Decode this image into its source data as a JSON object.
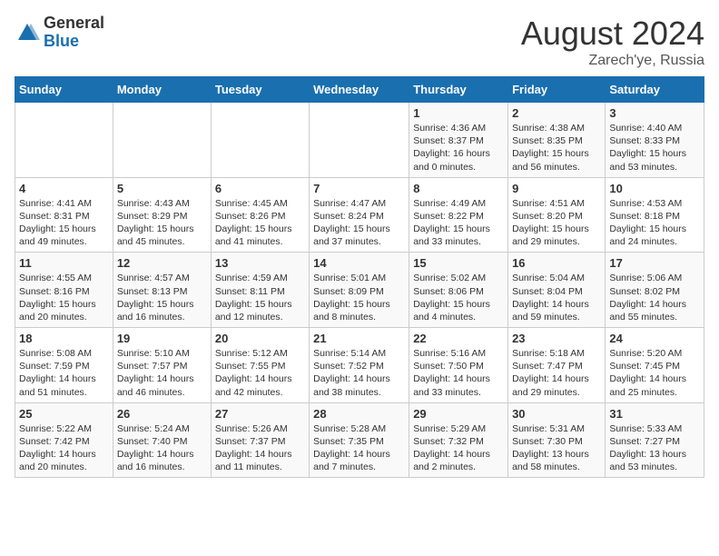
{
  "header": {
    "logo_general": "General",
    "logo_blue": "Blue",
    "month_year": "August 2024",
    "location": "Zarech'ye, Russia"
  },
  "days_of_week": [
    "Sunday",
    "Monday",
    "Tuesday",
    "Wednesday",
    "Thursday",
    "Friday",
    "Saturday"
  ],
  "weeks": [
    [
      {
        "num": "",
        "detail": ""
      },
      {
        "num": "",
        "detail": ""
      },
      {
        "num": "",
        "detail": ""
      },
      {
        "num": "",
        "detail": ""
      },
      {
        "num": "1",
        "detail": "Sunrise: 4:36 AM\nSunset: 8:37 PM\nDaylight: 16 hours\nand 0 minutes."
      },
      {
        "num": "2",
        "detail": "Sunrise: 4:38 AM\nSunset: 8:35 PM\nDaylight: 15 hours\nand 56 minutes."
      },
      {
        "num": "3",
        "detail": "Sunrise: 4:40 AM\nSunset: 8:33 PM\nDaylight: 15 hours\nand 53 minutes."
      }
    ],
    [
      {
        "num": "4",
        "detail": "Sunrise: 4:41 AM\nSunset: 8:31 PM\nDaylight: 15 hours\nand 49 minutes."
      },
      {
        "num": "5",
        "detail": "Sunrise: 4:43 AM\nSunset: 8:29 PM\nDaylight: 15 hours\nand 45 minutes."
      },
      {
        "num": "6",
        "detail": "Sunrise: 4:45 AM\nSunset: 8:26 PM\nDaylight: 15 hours\nand 41 minutes."
      },
      {
        "num": "7",
        "detail": "Sunrise: 4:47 AM\nSunset: 8:24 PM\nDaylight: 15 hours\nand 37 minutes."
      },
      {
        "num": "8",
        "detail": "Sunrise: 4:49 AM\nSunset: 8:22 PM\nDaylight: 15 hours\nand 33 minutes."
      },
      {
        "num": "9",
        "detail": "Sunrise: 4:51 AM\nSunset: 8:20 PM\nDaylight: 15 hours\nand 29 minutes."
      },
      {
        "num": "10",
        "detail": "Sunrise: 4:53 AM\nSunset: 8:18 PM\nDaylight: 15 hours\nand 24 minutes."
      }
    ],
    [
      {
        "num": "11",
        "detail": "Sunrise: 4:55 AM\nSunset: 8:16 PM\nDaylight: 15 hours\nand 20 minutes."
      },
      {
        "num": "12",
        "detail": "Sunrise: 4:57 AM\nSunset: 8:13 PM\nDaylight: 15 hours\nand 16 minutes."
      },
      {
        "num": "13",
        "detail": "Sunrise: 4:59 AM\nSunset: 8:11 PM\nDaylight: 15 hours\nand 12 minutes."
      },
      {
        "num": "14",
        "detail": "Sunrise: 5:01 AM\nSunset: 8:09 PM\nDaylight: 15 hours\nand 8 minutes."
      },
      {
        "num": "15",
        "detail": "Sunrise: 5:02 AM\nSunset: 8:06 PM\nDaylight: 15 hours\nand 4 minutes."
      },
      {
        "num": "16",
        "detail": "Sunrise: 5:04 AM\nSunset: 8:04 PM\nDaylight: 14 hours\nand 59 minutes."
      },
      {
        "num": "17",
        "detail": "Sunrise: 5:06 AM\nSunset: 8:02 PM\nDaylight: 14 hours\nand 55 minutes."
      }
    ],
    [
      {
        "num": "18",
        "detail": "Sunrise: 5:08 AM\nSunset: 7:59 PM\nDaylight: 14 hours\nand 51 minutes."
      },
      {
        "num": "19",
        "detail": "Sunrise: 5:10 AM\nSunset: 7:57 PM\nDaylight: 14 hours\nand 46 minutes."
      },
      {
        "num": "20",
        "detail": "Sunrise: 5:12 AM\nSunset: 7:55 PM\nDaylight: 14 hours\nand 42 minutes."
      },
      {
        "num": "21",
        "detail": "Sunrise: 5:14 AM\nSunset: 7:52 PM\nDaylight: 14 hours\nand 38 minutes."
      },
      {
        "num": "22",
        "detail": "Sunrise: 5:16 AM\nSunset: 7:50 PM\nDaylight: 14 hours\nand 33 minutes."
      },
      {
        "num": "23",
        "detail": "Sunrise: 5:18 AM\nSunset: 7:47 PM\nDaylight: 14 hours\nand 29 minutes."
      },
      {
        "num": "24",
        "detail": "Sunrise: 5:20 AM\nSunset: 7:45 PM\nDaylight: 14 hours\nand 25 minutes."
      }
    ],
    [
      {
        "num": "25",
        "detail": "Sunrise: 5:22 AM\nSunset: 7:42 PM\nDaylight: 14 hours\nand 20 minutes."
      },
      {
        "num": "26",
        "detail": "Sunrise: 5:24 AM\nSunset: 7:40 PM\nDaylight: 14 hours\nand 16 minutes."
      },
      {
        "num": "27",
        "detail": "Sunrise: 5:26 AM\nSunset: 7:37 PM\nDaylight: 14 hours\nand 11 minutes."
      },
      {
        "num": "28",
        "detail": "Sunrise: 5:28 AM\nSunset: 7:35 PM\nDaylight: 14 hours\nand 7 minutes."
      },
      {
        "num": "29",
        "detail": "Sunrise: 5:29 AM\nSunset: 7:32 PM\nDaylight: 14 hours\nand 2 minutes."
      },
      {
        "num": "30",
        "detail": "Sunrise: 5:31 AM\nSunset: 7:30 PM\nDaylight: 13 hours\nand 58 minutes."
      },
      {
        "num": "31",
        "detail": "Sunrise: 5:33 AM\nSunset: 7:27 PM\nDaylight: 13 hours\nand 53 minutes."
      }
    ]
  ]
}
